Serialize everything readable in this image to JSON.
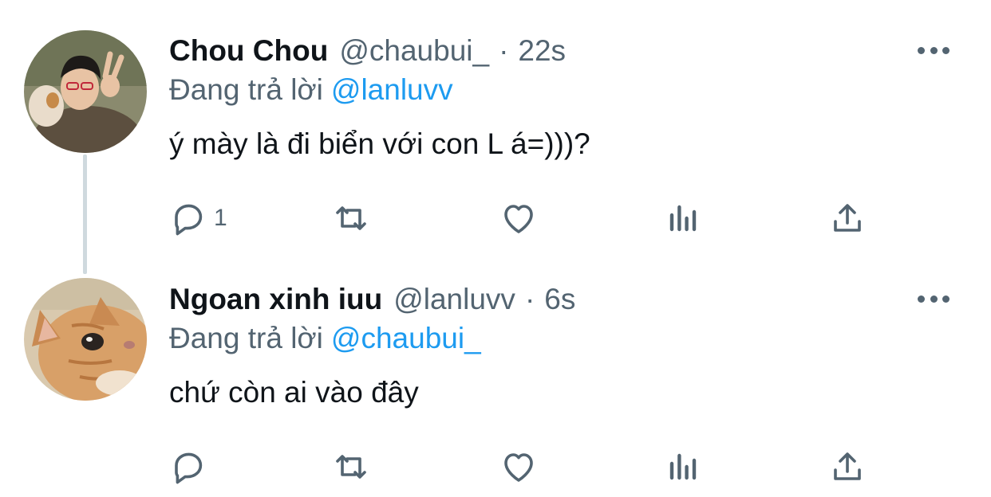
{
  "tweets": [
    {
      "display_name": "Chou Chou",
      "handle": "@chaubui_",
      "separator": "·",
      "time": "22s",
      "reply_prefix": "Đang trả lời",
      "reply_to": "@lanluvv",
      "text": "ý mày là đi biển với con L á=)))?",
      "reply_count": "1",
      "avatar": "person-photo-avatar"
    },
    {
      "display_name": "Ngoan xinh iuu",
      "handle": "@lanluvv",
      "separator": "·",
      "time": "6s",
      "reply_prefix": "Đang trả lời",
      "reply_to": "@chaubui_",
      "text": "chứ còn ai vào đây",
      "reply_count": "",
      "avatar": "cat-photo-avatar"
    }
  ],
  "colors": {
    "text": "#0f1419",
    "secondary": "#536471",
    "link": "#1d9bf0",
    "thread_line": "#cfd9de"
  },
  "icons": [
    "reply-icon",
    "retweet-icon",
    "like-icon",
    "views-icon",
    "share-icon",
    "more-icon"
  ]
}
